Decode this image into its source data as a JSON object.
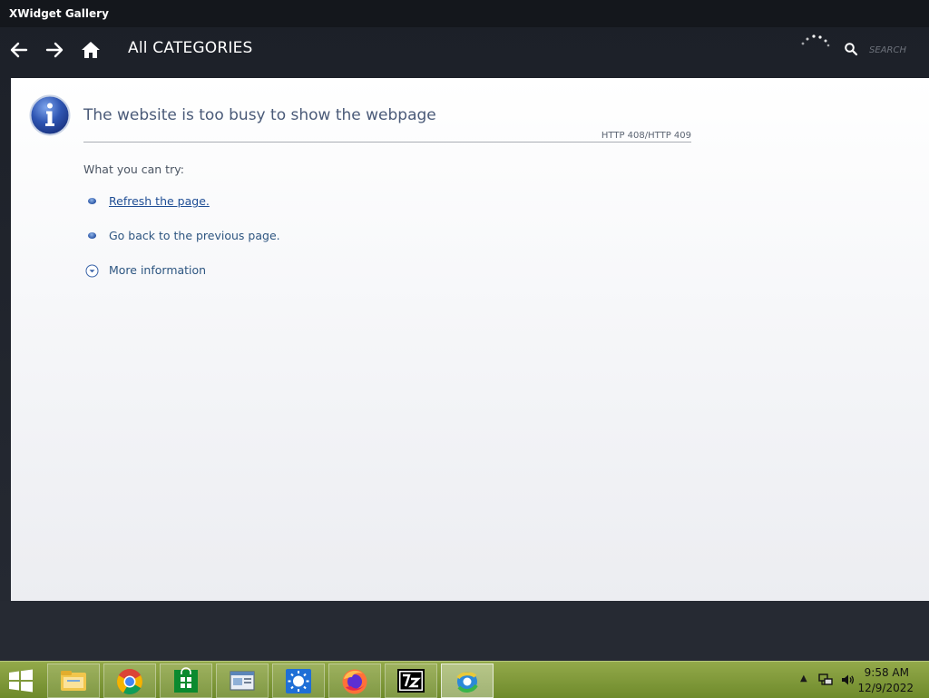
{
  "window": {
    "title": "XWidget Gallery"
  },
  "nav": {
    "category_title": "All CATEGORIES",
    "search_placeholder": "SEARCH"
  },
  "error_page": {
    "title": "The website is too busy to show the webpage",
    "code": "HTTP 408/HTTP 409",
    "try_heading": "What you can try:",
    "suggestions": [
      {
        "label": "Refresh the page."
      },
      {
        "label": "Go back to the previous page."
      }
    ],
    "more_info": "More information"
  },
  "taskbar": {
    "apps": [
      {
        "name": "file-explorer-icon"
      },
      {
        "name": "chrome-icon"
      },
      {
        "name": "store-icon"
      },
      {
        "name": "window-app-icon"
      },
      {
        "name": "sun-app-icon"
      },
      {
        "name": "firefox-icon"
      },
      {
        "name": "7zip-icon"
      },
      {
        "name": "xwidget-icon",
        "active": true
      }
    ],
    "clock": {
      "time": "9:58 AM",
      "date": "12/9/2022"
    }
  },
  "colors": {
    "accent": "#2752a3",
    "taskbar": "#7f9a38",
    "link": "#1f4e95"
  }
}
